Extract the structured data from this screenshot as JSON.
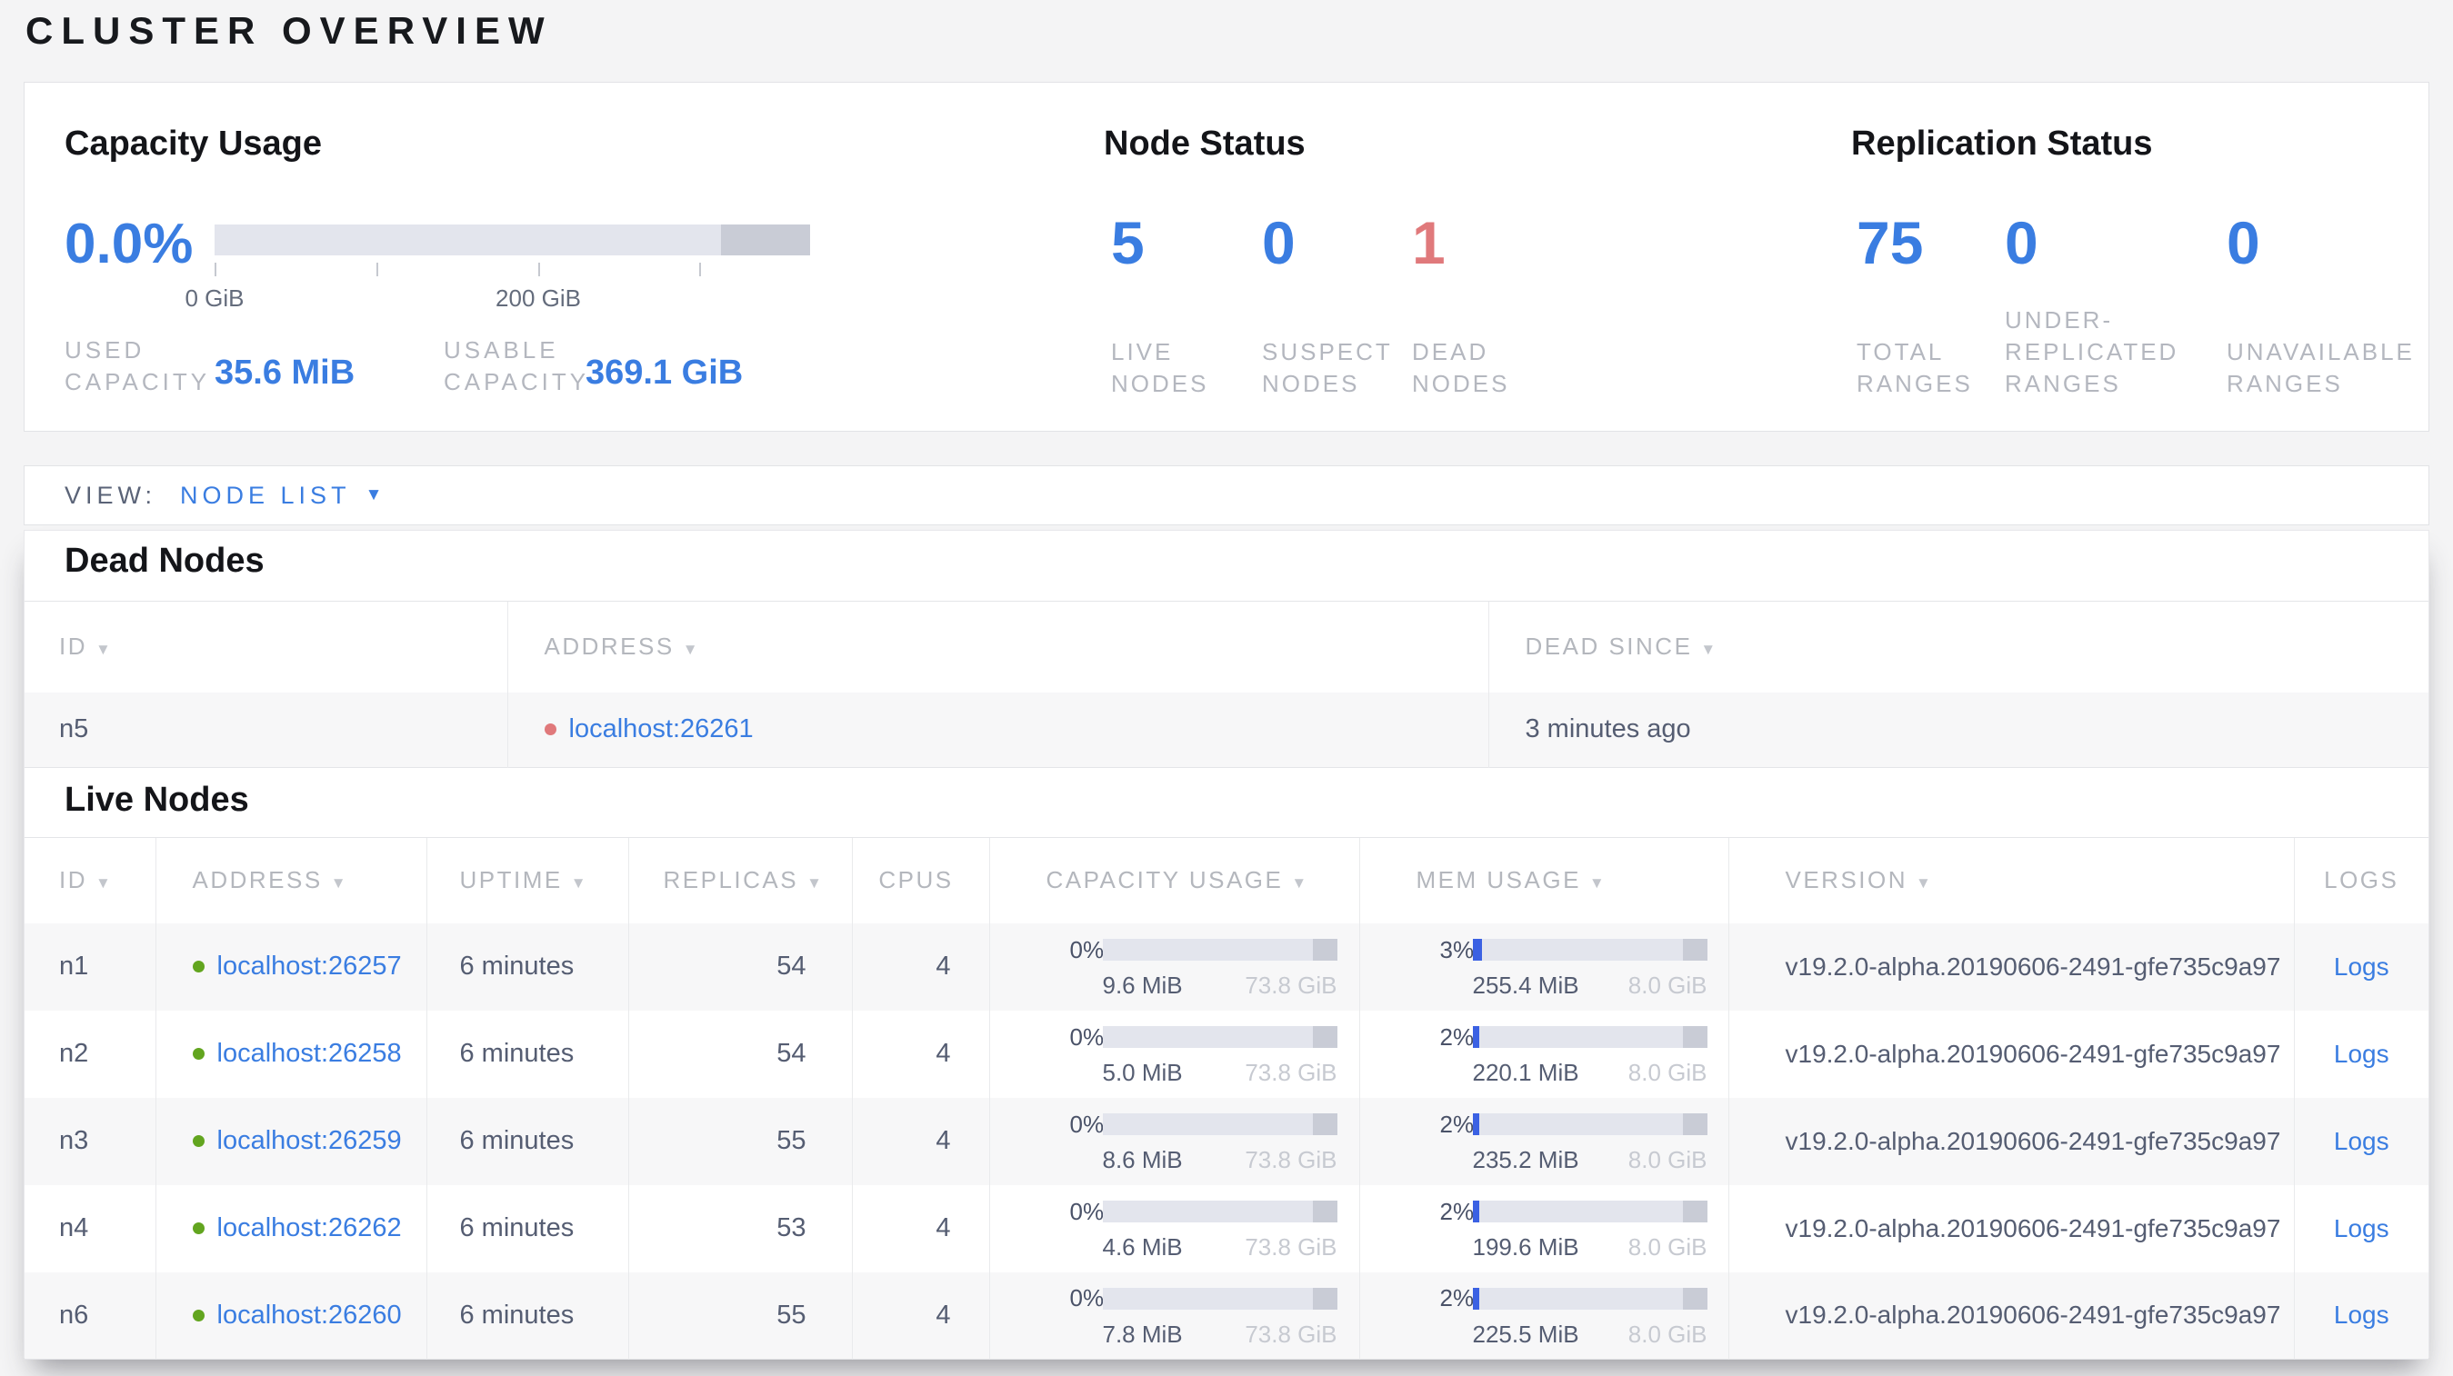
{
  "page": {
    "title": "CLUSTER OVERVIEW"
  },
  "summary": {
    "capacity": {
      "title": "Capacity Usage",
      "pct": "0.0%",
      "tick_labels": [
        "0 GiB",
        "200 GiB"
      ],
      "used_label": "USED CAPACITY",
      "used_value": "35.6 MiB",
      "usable_label": "USABLE CAPACITY",
      "usable_value": "369.1 GiB"
    },
    "node_status": {
      "title": "Node Status",
      "stats": [
        {
          "value": "5",
          "label": "LIVE NODES"
        },
        {
          "value": "0",
          "label": "SUSPECT NODES"
        },
        {
          "value": "1",
          "label": "DEAD NODES"
        }
      ]
    },
    "replication": {
      "title": "Replication Status",
      "stats": [
        {
          "value": "75",
          "label": "TOTAL RANGES"
        },
        {
          "value": "0",
          "label": "UNDER-REPLICATED RANGES"
        },
        {
          "value": "0",
          "label": "UNAVAILABLE RANGES"
        }
      ]
    }
  },
  "view_bar": {
    "label": "VIEW:",
    "selected": "NODE LIST"
  },
  "dead_nodes": {
    "title": "Dead Nodes",
    "columns": [
      {
        "label": "ID",
        "sortable": true
      },
      {
        "label": "ADDRESS",
        "sortable": true
      },
      {
        "label": "DEAD SINCE",
        "sortable": true
      }
    ],
    "rows": [
      {
        "id": "n5",
        "address": "localhost:26261",
        "dead_since": "3 minutes ago"
      }
    ]
  },
  "live_nodes": {
    "title": "Live Nodes",
    "columns": [
      {
        "label": "ID",
        "sortable": true
      },
      {
        "label": "ADDRESS",
        "sortable": true
      },
      {
        "label": "UPTIME",
        "sortable": true
      },
      {
        "label": "REPLICAS",
        "sortable": true
      },
      {
        "label": "CPUS",
        "sortable": false
      },
      {
        "label": "CAPACITY USAGE",
        "sortable": true
      },
      {
        "label": "MEM USAGE",
        "sortable": true
      },
      {
        "label": "VERSION",
        "sortable": true
      },
      {
        "label": "LOGS",
        "sortable": false
      }
    ],
    "rows": [
      {
        "id": "n1",
        "address": "localhost:26257",
        "uptime": "6 minutes",
        "replicas": "54",
        "cpus": "4",
        "capacity": {
          "pct": 0,
          "pct_label": "0%",
          "used": "9.6 MiB",
          "total": "73.8 GiB"
        },
        "mem": {
          "pct": 3,
          "pct_label": "3%",
          "used": "255.4 MiB",
          "total": "8.0 GiB"
        },
        "version": "v19.2.0-alpha.20190606-2491-gfe735c9a97",
        "logs": "Logs"
      },
      {
        "id": "n2",
        "address": "localhost:26258",
        "uptime": "6 minutes",
        "replicas": "54",
        "cpus": "4",
        "capacity": {
          "pct": 0,
          "pct_label": "0%",
          "used": "5.0 MiB",
          "total": "73.8 GiB"
        },
        "mem": {
          "pct": 2,
          "pct_label": "2%",
          "used": "220.1 MiB",
          "total": "8.0 GiB"
        },
        "version": "v19.2.0-alpha.20190606-2491-gfe735c9a97",
        "logs": "Logs"
      },
      {
        "id": "n3",
        "address": "localhost:26259",
        "uptime": "6 minutes",
        "replicas": "55",
        "cpus": "4",
        "capacity": {
          "pct": 0,
          "pct_label": "0%",
          "used": "8.6 MiB",
          "total": "73.8 GiB"
        },
        "mem": {
          "pct": 2,
          "pct_label": "2%",
          "used": "235.2 MiB",
          "total": "8.0 GiB"
        },
        "version": "v19.2.0-alpha.20190606-2491-gfe735c9a97",
        "logs": "Logs"
      },
      {
        "id": "n4",
        "address": "localhost:26262",
        "uptime": "6 minutes",
        "replicas": "53",
        "cpus": "4",
        "capacity": {
          "pct": 0,
          "pct_label": "0%",
          "used": "4.6 MiB",
          "total": "73.8 GiB"
        },
        "mem": {
          "pct": 2,
          "pct_label": "2%",
          "used": "199.6 MiB",
          "total": "8.0 GiB"
        },
        "version": "v19.2.0-alpha.20190606-2491-gfe735c9a97",
        "logs": "Logs"
      },
      {
        "id": "n6",
        "address": "localhost:26260",
        "uptime": "6 minutes",
        "replicas": "55",
        "cpus": "4",
        "capacity": {
          "pct": 0,
          "pct_label": "0%",
          "used": "7.8 MiB",
          "total": "73.8 GiB"
        },
        "mem": {
          "pct": 2,
          "pct_label": "2%",
          "used": "225.5 MiB",
          "total": "8.0 GiB"
        },
        "version": "v19.2.0-alpha.20190606-2491-gfe735c9a97",
        "logs": "Logs"
      }
    ]
  },
  "colors": {
    "accent_blue": "#3a7de1",
    "dead_red": "#e0797b",
    "live_green": "#62a51f",
    "bar_track": "#e3e5ed",
    "bar_reserved": "#c9ccd6",
    "mem_fill": "#3b61e3"
  }
}
